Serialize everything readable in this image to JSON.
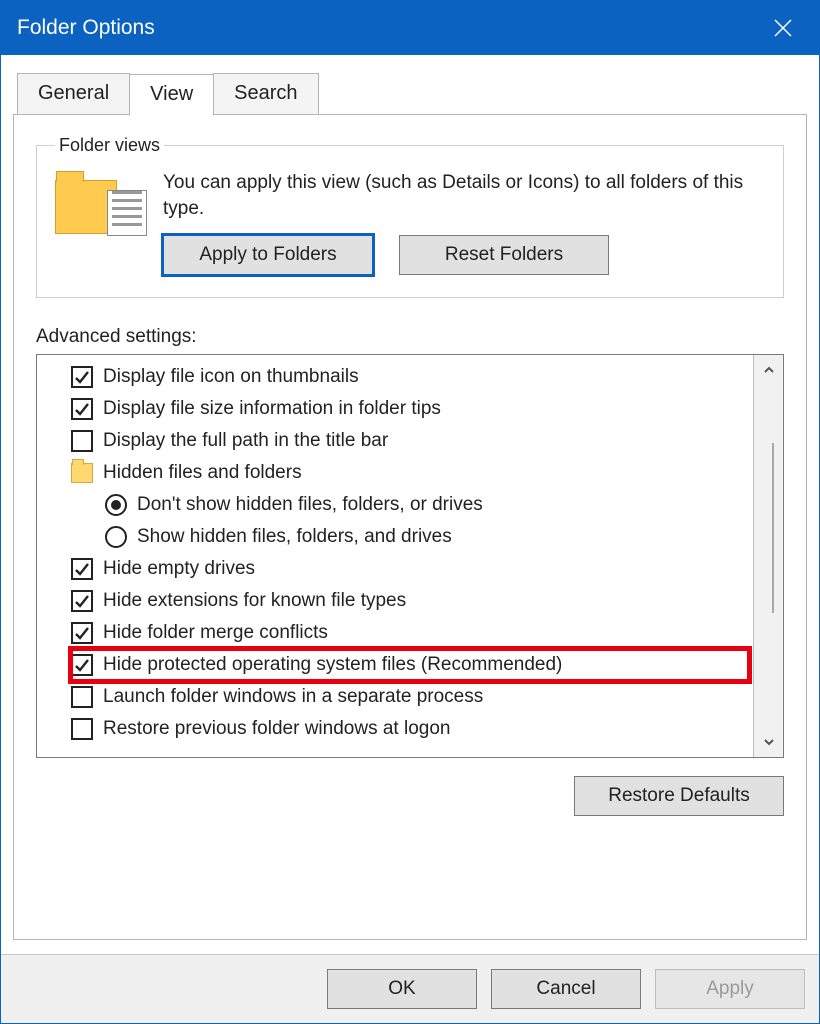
{
  "window": {
    "title": "Folder Options"
  },
  "tabs": {
    "general": "General",
    "view": "View",
    "search": "Search"
  },
  "folderViews": {
    "legend": "Folder views",
    "description": "You can apply this view (such as Details or Icons) to all folders of this type.",
    "applyButton": "Apply to Folders",
    "resetButton": "Reset Folders"
  },
  "advanced": {
    "label": "Advanced settings:",
    "items": [
      {
        "type": "check",
        "checked": true,
        "label": "Display file icon on thumbnails"
      },
      {
        "type": "check",
        "checked": true,
        "label": "Display file size information in folder tips"
      },
      {
        "type": "check",
        "checked": false,
        "label": "Display the full path in the title bar"
      },
      {
        "type": "folder",
        "label": "Hidden files and folders"
      },
      {
        "type": "radio",
        "checked": true,
        "label": "Don't show hidden files, folders, or drives"
      },
      {
        "type": "radio",
        "checked": false,
        "label": "Show hidden files, folders, and drives"
      },
      {
        "type": "check",
        "checked": true,
        "label": "Hide empty drives"
      },
      {
        "type": "check",
        "checked": true,
        "label": "Hide extensions for known file types"
      },
      {
        "type": "check",
        "checked": true,
        "label": "Hide folder merge conflicts"
      },
      {
        "type": "check",
        "checked": true,
        "label": "Hide protected operating system files (Recommended)",
        "highlight": true
      },
      {
        "type": "check",
        "checked": false,
        "label": "Launch folder windows in a separate process"
      },
      {
        "type": "check",
        "checked": false,
        "label": "Restore previous folder windows at logon"
      }
    ],
    "restoreDefaults": "Restore Defaults"
  },
  "footer": {
    "ok": "OK",
    "cancel": "Cancel",
    "apply": "Apply"
  }
}
